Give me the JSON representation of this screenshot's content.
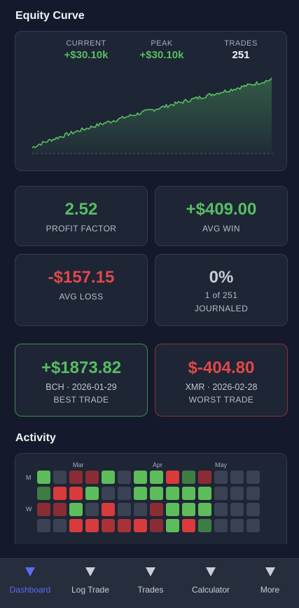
{
  "equity": {
    "title": "Equity Curve",
    "stats": [
      {
        "label": "CURRENT",
        "value": "+$30.10k",
        "tone": "green"
      },
      {
        "label": "PEAK",
        "value": "+$30.10k",
        "tone": "green"
      },
      {
        "label": "TRADES",
        "value": "251",
        "tone": "white"
      }
    ]
  },
  "metrics": [
    {
      "value": "2.52",
      "label": "PROFIT FACTOR",
      "tone": "green"
    },
    {
      "value": "+$409.00",
      "label": "AVG WIN",
      "tone": "green"
    },
    {
      "value": "-$157.15",
      "label": "AVG LOSS",
      "tone": "red"
    },
    {
      "value": "0%",
      "detail": "1 of 251",
      "label": "JOURNALED",
      "tone": "gray"
    }
  ],
  "best_trade": {
    "value": "+$1873.82",
    "meta": "BCH · 2026-01-29",
    "label": "BEST TRADE"
  },
  "worst_trade": {
    "value": "$-404.80",
    "meta": "XMR · 2026-02-28",
    "label": "WORST TRADE"
  },
  "activity": {
    "title": "Activity",
    "months": [
      "Mar",
      "Apr",
      "May"
    ],
    "day_labels": [
      "M",
      "W"
    ],
    "colors": {
      "G": "#5dbd5a",
      "g": "#3d7d44",
      "R": "#d93a3c",
      "r": "#8a2c33",
      "e": "#3a4254",
      "m": "#a83236"
    },
    "rows": [
      "GerrGeGGRgreee",
      "gRRGeeGGGGGeee",
      "rrGeReerGGGeee",
      "eeRRmmRrGRgeee"
    ]
  },
  "nav": {
    "items": [
      {
        "label": "Dashboard",
        "active": true
      },
      {
        "label": "Log Trade",
        "active": false
      },
      {
        "label": "Trades",
        "active": false
      },
      {
        "label": "Calculator",
        "active": false
      },
      {
        "label": "More",
        "active": false
      }
    ]
  },
  "accent": "#5b6cf0",
  "green": "#58bd63",
  "red": "#e0484a"
}
